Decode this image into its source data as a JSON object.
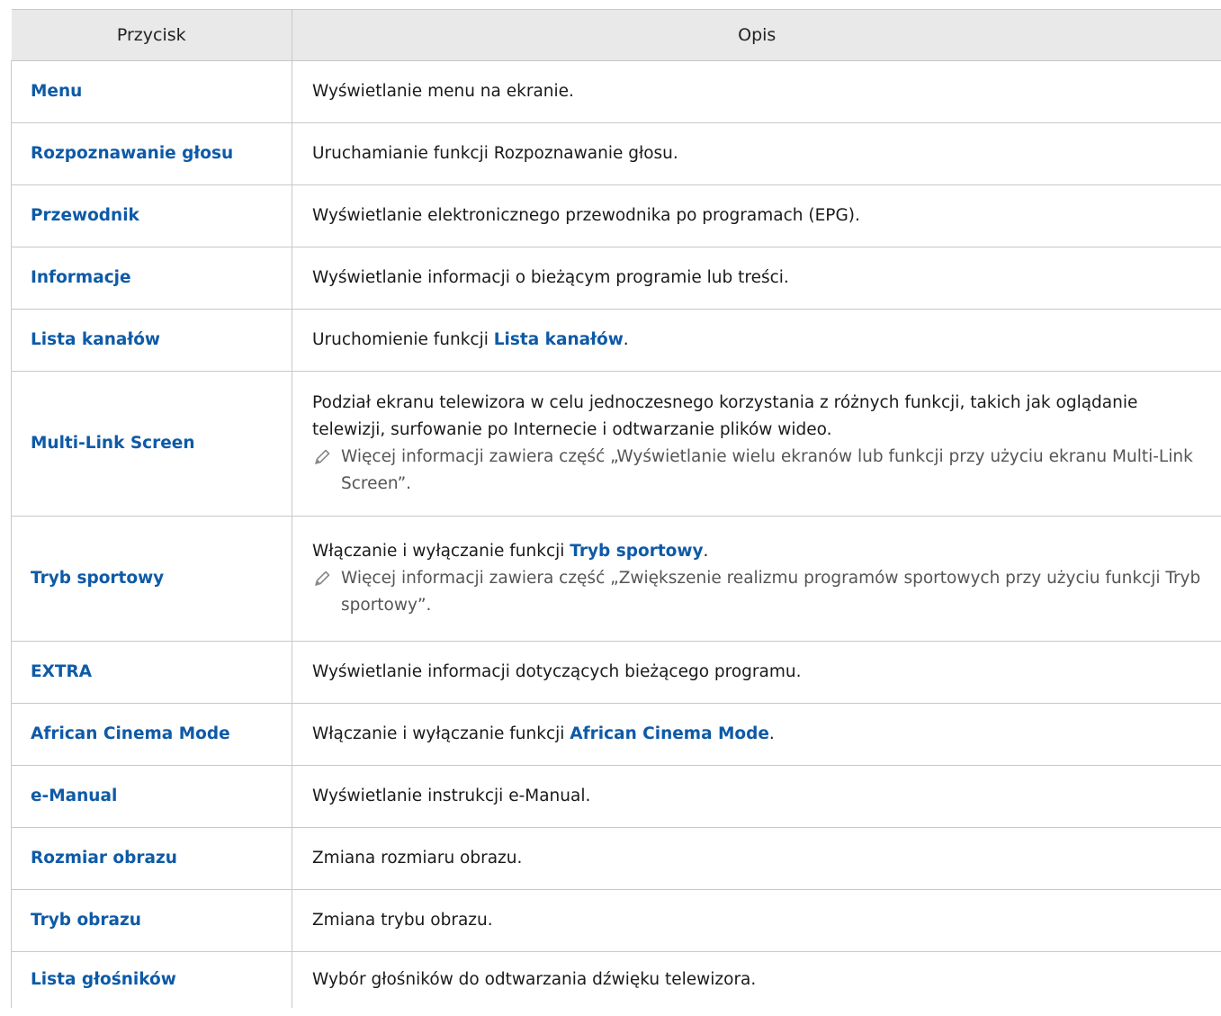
{
  "header": {
    "col1": "Przycisk",
    "col2": "Opis"
  },
  "rows": [
    {
      "key": "Menu",
      "desc": "Wyświetlanie menu na ekranie."
    },
    {
      "key": "Rozpoznawanie głosu",
      "desc": "Uruchamianie funkcji Rozpoznawanie głosu."
    },
    {
      "key": "Przewodnik",
      "desc": "Wyświetlanie elektronicznego przewodnika po programach (EPG)."
    },
    {
      "key": "Informacje",
      "desc": "Wyświetlanie informacji o bieżącym programie lub treści."
    },
    {
      "key": "Lista kanałów",
      "desc_pre": "Uruchomienie funkcji ",
      "desc_hl": "Lista kanałów",
      "desc_post": "."
    },
    {
      "key": "Multi-Link Screen",
      "desc": "Podział ekranu telewizora w celu jednoczesnego korzystania z różnych funkcji, takich jak oglądanie telewizji, surfowanie po Internecie i odtwarzanie plików wideo.",
      "note": "Więcej informacji zawiera część „Wyświetlanie wielu ekranów lub funkcji przy użyciu ekranu Multi-Link Screen”."
    },
    {
      "key": "Tryb sportowy",
      "desc_pre": "Włączanie i wyłączanie funkcji ",
      "desc_hl": "Tryb sportowy",
      "desc_post": ".",
      "note": "Więcej informacji zawiera część „Zwiększenie realizmu programów sportowych przy użyciu funkcji Tryb sportowy”."
    },
    {
      "key": "EXTRA",
      "desc": "Wyświetlanie informacji dotyczących bieżącego programu."
    },
    {
      "key": "African Cinema Mode",
      "desc_pre": "Włączanie i wyłączanie funkcji ",
      "desc_hl": "African Cinema Mode",
      "desc_post": "."
    },
    {
      "key": "e-Manual",
      "desc": "Wyświetlanie instrukcji e-Manual."
    },
    {
      "key": "Rozmiar obrazu",
      "desc": "Zmiana rozmiaru obrazu."
    },
    {
      "key": "Tryb obrazu",
      "desc": "Zmiana trybu obrazu."
    },
    {
      "key": "Lista głośników",
      "desc": "Wybór głośników do odtwarzania dźwięku telewizora."
    }
  ],
  "icons": {
    "note": "pencil-icon"
  },
  "colors": {
    "accent": "#0e5aa7",
    "header_bg": "#e9e9e9",
    "border": "#c8c8c8"
  }
}
